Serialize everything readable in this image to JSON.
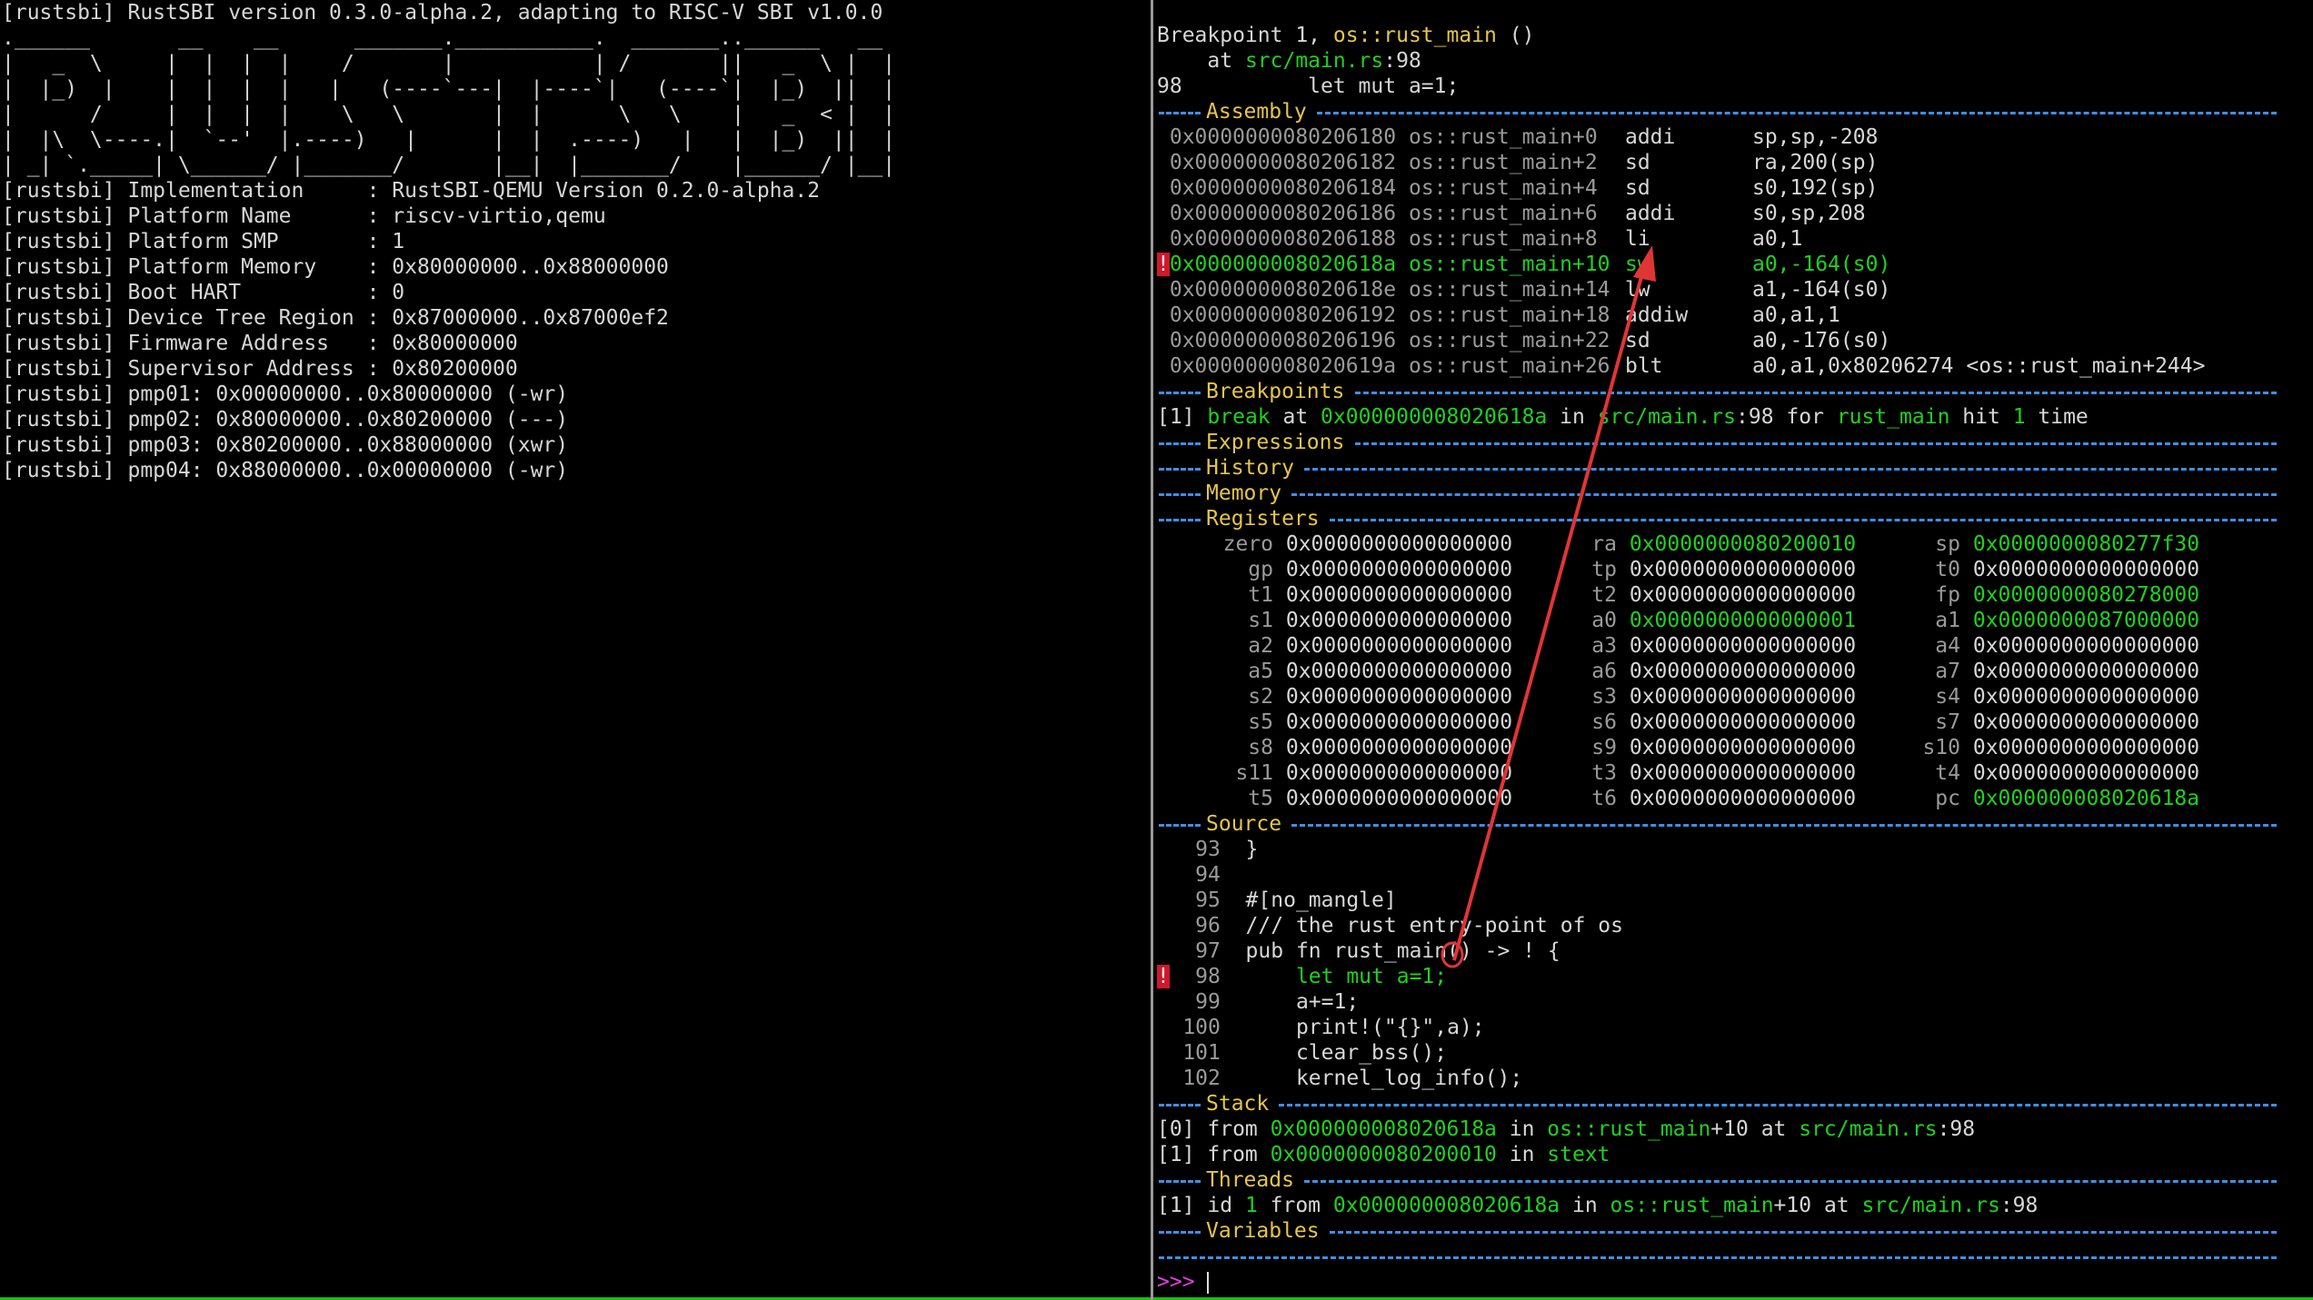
{
  "left": {
    "lines": [
      "[rustsbi] RustSBI version 0.3.0-alpha.2, adapting to RISC-V SBI v1.0.0",
      ".______       __    __      _______.___________.  _______..______   __",
      "|   _  \\     |  |  |  |    /       |           | /       ||   _  \\ |  |",
      "|  |_)  |    |  |  |  |   |   (----`---|  |----`|   (----`|  |_)  ||  |",
      "|      /     |  |  |  |    \\   \\       |  |      \\   \\    |   _  < |  |",
      "|  |\\  \\----.|  `--'  |.----)   |      |  |  .----)   |   |  |_)  ||  |",
      "| _| `._____| \\______/ |_______/       |__|  |_______/    |______/ |__|",
      "[rustsbi] Implementation     : RustSBI-QEMU Version 0.2.0-alpha.2",
      "[rustsbi] Platform Name      : riscv-virtio,qemu",
      "[rustsbi] Platform SMP       : 1",
      "[rustsbi] Platform Memory    : 0x80000000..0x88000000",
      "[rustsbi] Boot HART          : 0",
      "[rustsbi] Device Tree Region : 0x87000000..0x87000ef2",
      "[rustsbi] Firmware Address   : 0x80000000",
      "[rustsbi] Supervisor Address : 0x80200000",
      "[rustsbi] pmp01: 0x00000000..0x80000000 (-wr)",
      "[rustsbi] pmp02: 0x80000000..0x80200000 (---)",
      "[rustsbi] pmp03: 0x80200000..0x88000000 (xwr)",
      "[rustsbi] pmp04: 0x88000000..0x00000000 (-wr)"
    ]
  },
  "right": {
    "bp_header": {
      "prefix": "Breakpoint 1, ",
      "func": "os::rust_main",
      "suffix": " ()",
      "at_prefix": "    at ",
      "at_file": "src/main.rs",
      "at_line": ":98",
      "src_line": "98          let mut a=1;"
    },
    "sections": {
      "assembly": "Assembly",
      "breakpoints": "Breakpoints",
      "expressions": "Expressions",
      "history": "History",
      "memory": "Memory",
      "registers": "Registers",
      "source": "Source",
      "stack": "Stack",
      "threads": "Threads",
      "variables": "Variables"
    },
    "assembly": [
      {
        "mark": " ",
        "addr": "0x0000000080206180",
        "sym": "os::rust_main+0",
        "op": "addi",
        "args": "sp,sp,-208",
        "cur": false
      },
      {
        "mark": " ",
        "addr": "0x0000000080206182",
        "sym": "os::rust_main+2",
        "op": "sd",
        "args": "ra,200(sp)",
        "cur": false
      },
      {
        "mark": " ",
        "addr": "0x0000000080206184",
        "sym": "os::rust_main+4",
        "op": "sd",
        "args": "s0,192(sp)",
        "cur": false
      },
      {
        "mark": " ",
        "addr": "0x0000000080206186",
        "sym": "os::rust_main+6",
        "op": "addi",
        "args": "s0,sp,208",
        "cur": false
      },
      {
        "mark": " ",
        "addr": "0x0000000080206188",
        "sym": "os::rust_main+8",
        "op": "li",
        "args": "a0,1",
        "cur": false
      },
      {
        "mark": "!",
        "addr": "0x000000008020618a",
        "sym": "os::rust_main+10",
        "op": "sw",
        "args": "a0,-164(s0)",
        "cur": true
      },
      {
        "mark": " ",
        "addr": "0x000000008020618e",
        "sym": "os::rust_main+14",
        "op": "lw",
        "args": "a1,-164(s0)",
        "cur": false
      },
      {
        "mark": " ",
        "addr": "0x0000000080206192",
        "sym": "os::rust_main+18",
        "op": "addiw",
        "args": "a0,a1,1",
        "cur": false
      },
      {
        "mark": " ",
        "addr": "0x0000000080206196",
        "sym": "os::rust_main+22",
        "op": "sd",
        "args": "a0,-176(s0)",
        "cur": false
      },
      {
        "mark": " ",
        "addr": "0x000000008020619a",
        "sym": "os::rust_main+26",
        "op": "blt",
        "args": "a0,a1,0x80206274 <os::rust_main+244>",
        "cur": false
      }
    ],
    "breakpoint_line": {
      "idx": "[1]",
      "kw": "break",
      "at": " at ",
      "addr": "0x000000008020618a",
      "in": " in ",
      "file": "src/main.rs",
      "line": ":98",
      "for": " for ",
      "func": "rust_main",
      "hit": " hit ",
      "count": "1",
      "time": " time"
    },
    "registers": [
      [
        {
          "n": "zero",
          "v": "0x0000000000000000",
          "c": false
        },
        {
          "n": "ra",
          "v": "0x0000000080200010",
          "c": true
        },
        {
          "n": "sp",
          "v": "0x0000000080277f30",
          "c": true
        }
      ],
      [
        {
          "n": "gp",
          "v": "0x0000000000000000",
          "c": false
        },
        {
          "n": "tp",
          "v": "0x0000000000000000",
          "c": false
        },
        {
          "n": "t0",
          "v": "0x0000000000000000",
          "c": false
        }
      ],
      [
        {
          "n": "t1",
          "v": "0x0000000000000000",
          "c": false
        },
        {
          "n": "t2",
          "v": "0x0000000000000000",
          "c": false
        },
        {
          "n": "fp",
          "v": "0x0000000080278000",
          "c": true
        }
      ],
      [
        {
          "n": "s1",
          "v": "0x0000000000000000",
          "c": false
        },
        {
          "n": "a0",
          "v": "0x0000000000000001",
          "c": true
        },
        {
          "n": "a1",
          "v": "0x0000000087000000",
          "c": true
        }
      ],
      [
        {
          "n": "a2",
          "v": "0x0000000000000000",
          "c": false
        },
        {
          "n": "a3",
          "v": "0x0000000000000000",
          "c": false
        },
        {
          "n": "a4",
          "v": "0x0000000000000000",
          "c": false
        }
      ],
      [
        {
          "n": "a5",
          "v": "0x0000000000000000",
          "c": false
        },
        {
          "n": "a6",
          "v": "0x0000000000000000",
          "c": false
        },
        {
          "n": "a7",
          "v": "0x0000000000000000",
          "c": false
        }
      ],
      [
        {
          "n": "s2",
          "v": "0x0000000000000000",
          "c": false
        },
        {
          "n": "s3",
          "v": "0x0000000000000000",
          "c": false
        },
        {
          "n": "s4",
          "v": "0x0000000000000000",
          "c": false
        }
      ],
      [
        {
          "n": "s5",
          "v": "0x0000000000000000",
          "c": false
        },
        {
          "n": "s6",
          "v": "0x0000000000000000",
          "c": false
        },
        {
          "n": "s7",
          "v": "0x0000000000000000",
          "c": false
        }
      ],
      [
        {
          "n": "s8",
          "v": "0x0000000000000000",
          "c": false
        },
        {
          "n": "s9",
          "v": "0x0000000000000000",
          "c": false
        },
        {
          "n": "s10",
          "v": "0x0000000000000000",
          "c": false
        }
      ],
      [
        {
          "n": "s11",
          "v": "0x0000000000000000",
          "c": false
        },
        {
          "n": "t3",
          "v": "0x0000000000000000",
          "c": false
        },
        {
          "n": "t4",
          "v": "0x0000000000000000",
          "c": false
        }
      ],
      [
        {
          "n": "t5",
          "v": "0x0000000000000000",
          "c": false
        },
        {
          "n": "t6",
          "v": "0x0000000000000000",
          "c": false
        },
        {
          "n": "pc",
          "v": "0x000000008020618a",
          "c": true
        }
      ]
    ],
    "source": [
      {
        "mark": " ",
        "num": "93",
        "code": "  }",
        "cur": false
      },
      {
        "mark": " ",
        "num": "94",
        "code": "",
        "cur": false
      },
      {
        "mark": " ",
        "num": "95",
        "code": "  #[no_mangle]",
        "cur": false
      },
      {
        "mark": " ",
        "num": "96",
        "code": "  /// the rust entry-point of os",
        "cur": false
      },
      {
        "mark": " ",
        "num": "97",
        "code": "  pub fn rust_main() -> ! {",
        "cur": false
      },
      {
        "mark": "!",
        "num": "98",
        "code": "      let mut a=1;",
        "cur": true
      },
      {
        "mark": " ",
        "num": "99",
        "code": "      a+=1;",
        "cur": false
      },
      {
        "mark": " ",
        "num": "100",
        "code": "      print!(\"{}\",a);",
        "cur": false
      },
      {
        "mark": " ",
        "num": "101",
        "code": "      clear_bss();",
        "cur": false
      },
      {
        "mark": " ",
        "num": "102",
        "code": "      kernel_log_info();",
        "cur": false
      }
    ],
    "stack": [
      {
        "idx": "[0]",
        "from": " from ",
        "addr": "0x000000008020618a",
        "in": " in ",
        "func": "os::rust_main",
        "off": "+10",
        "at": " at ",
        "file": "src/main.rs",
        "line": ":98"
      },
      {
        "idx": "[1]",
        "from": " from ",
        "addr": "0x0000000080200010",
        "in": " in ",
        "func": "stext",
        "off": "",
        "at": "",
        "file": "",
        "line": ""
      }
    ],
    "thread": {
      "idx": "[1]",
      "id": " id ",
      "num": "1",
      "from": " from ",
      "addr": "0x000000008020618a",
      "in": " in ",
      "func": "os::rust_main",
      "off": "+10",
      "at": " at ",
      "file": "src/main.rs",
      "line": ":98"
    },
    "prompt": ">>>"
  },
  "colors": {
    "green": "#1fd11f",
    "yellow": "#e6c54a",
    "rule": "#3f8ee8",
    "arrow": "#e03535",
    "bp": "#d0182b",
    "prompt": "#e040e0"
  }
}
